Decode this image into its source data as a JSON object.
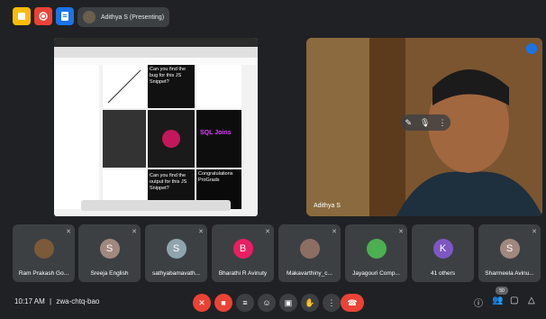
{
  "presenter": {
    "label": "Adithya S (Presenting)"
  },
  "camera": {
    "name": "Adithya S"
  },
  "screen_share": {
    "slides": [
      {
        "text": "Can you find the bug for this JS Snippet?"
      },
      {
        "text": "Can you find the output for this JS Snippet?"
      },
      {
        "text": "SQL Joins"
      },
      {
        "text": "Congratulations ProGrads"
      }
    ]
  },
  "participants": [
    {
      "name": "Ram Prakash Go...",
      "initial": "",
      "color": "#5f6368"
    },
    {
      "name": "Sreeja English",
      "initial": "S",
      "color": "#a1887f"
    },
    {
      "name": "sathyabamavath...",
      "initial": "S",
      "color": "#90a4ae"
    },
    {
      "name": "Bharathi R Avinuty",
      "initial": "B",
      "color": "#e91e63"
    },
    {
      "name": "Makavarthiny_c...",
      "initial": "",
      "color": "#8d6e63"
    },
    {
      "name": "Jayagouri Comp...",
      "initial": "",
      "color": "#4caf50"
    },
    {
      "name": "41 others",
      "initial": "K",
      "color": "#7e57c2"
    },
    {
      "name": "Sharmeela Avinu...",
      "initial": "S",
      "color": "#a1887f"
    }
  ],
  "bottom": {
    "time": "10:17 AM",
    "separator": "|",
    "meeting_code": "zwa-chtq-bao",
    "people_count": "50"
  }
}
